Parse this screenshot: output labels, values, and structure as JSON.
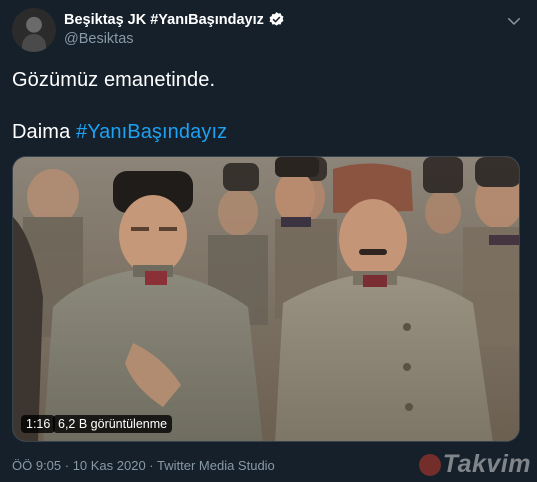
{
  "header": {
    "display_name": "Beşiktaş JK #YanıBaşındayız",
    "handle": "@Besiktas",
    "verified": true
  },
  "tweet": {
    "line1": "Gözümüz emanetinde.",
    "line2_word": "Daima",
    "line2_hashtag": "#YanıBaşındayız"
  },
  "video": {
    "duration": "1:16",
    "views": "6,2 B görüntülenme"
  },
  "meta": {
    "timestamp": "ÖÖ 9:05 · 10 Kas 2020 · Twitter Media Studio"
  },
  "watermark": {
    "text": "Takvim"
  },
  "colors": {
    "background": "#15202b",
    "accent": "#1da1f2",
    "muted": "#8899a6"
  },
  "icons": [
    "verified-badge-icon",
    "chevron-down-icon",
    "takvim-logo-icon"
  ]
}
